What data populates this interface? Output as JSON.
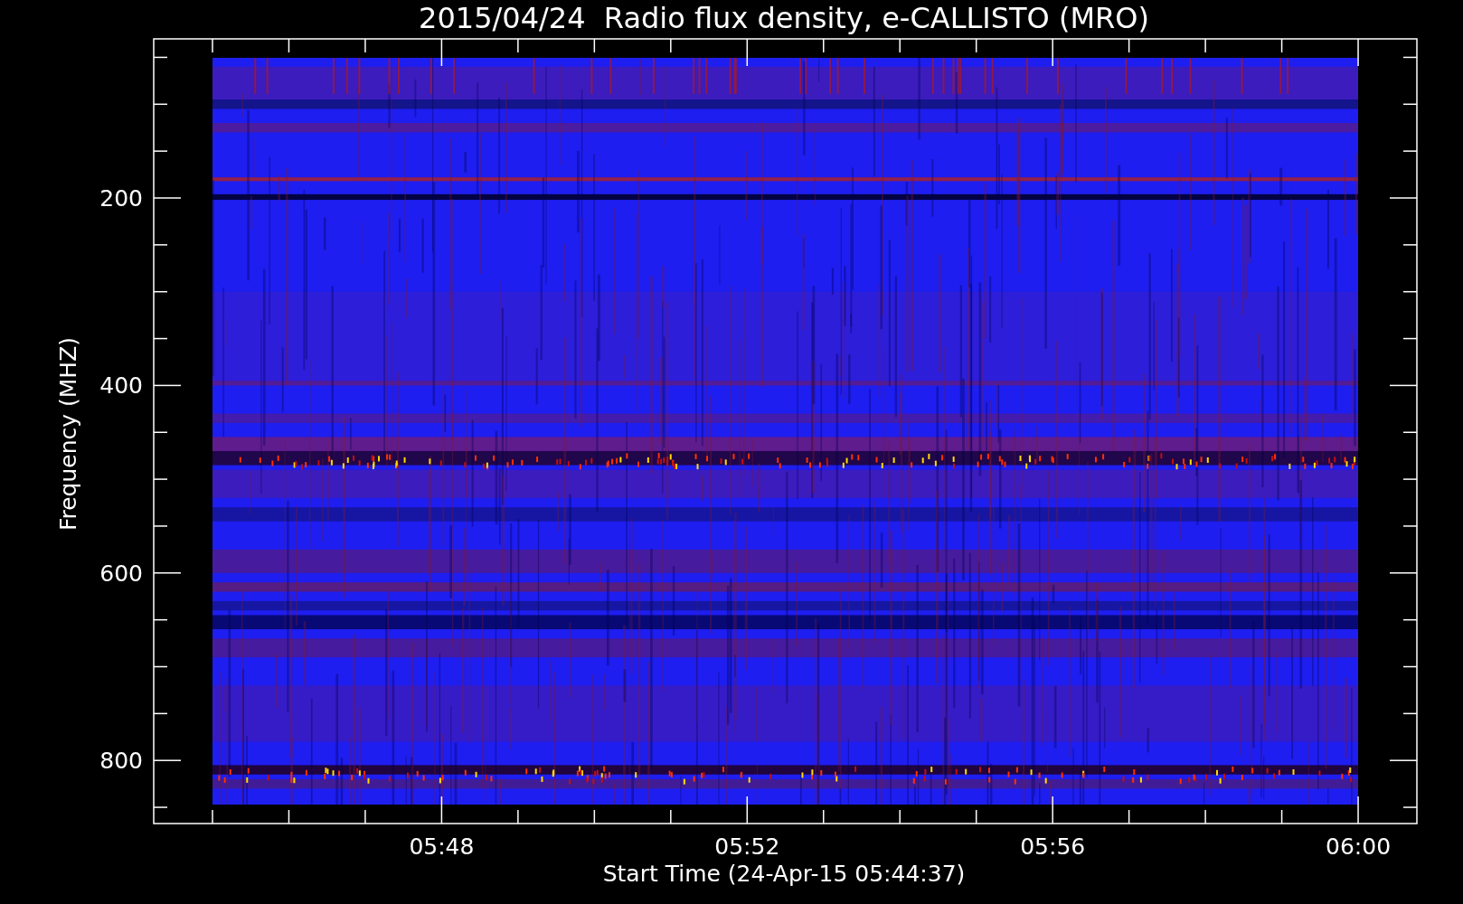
{
  "title": "2015/04/24  Radio flux density, e-CALLISTO (MRO)",
  "y_axis": {
    "label": "Frequency (MHZ)",
    "ticks": [
      "200",
      "400",
      "600",
      "800"
    ]
  },
  "x_axis": {
    "label": "Start Time (24-Apr-15 05:44:37)",
    "ticks": [
      "05:48",
      "05:52",
      "05:56",
      "06:00"
    ]
  }
}
